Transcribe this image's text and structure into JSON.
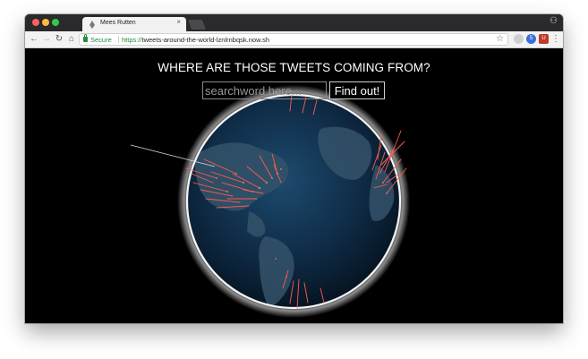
{
  "browser": {
    "tab_title": "Mees Rutten",
    "tab_close": "×",
    "secure_label": "Secure",
    "url_scheme": "https://",
    "url_rest": "tweets-around-the-world-lznlrnbqsk.now.sh",
    "icons": {
      "back": "back-arrow-icon",
      "forward": "forward-arrow-icon",
      "reload": "reload-icon",
      "home": "home-icon",
      "star": "bookmark-star-icon",
      "menu": "kebab-menu-icon",
      "profile": "incognito-profile-icon"
    },
    "glyphs": {
      "back": "←",
      "forward": "→",
      "reload": "↻",
      "home": "⌂",
      "star": "☆",
      "menu": "⋮",
      "profile": "⚇",
      "ext_badge": "5",
      "ext_shield": "U"
    }
  },
  "page": {
    "headline": "WHERE ARE THOSE TWEETS COMING FROM?",
    "search_placeholder": "searchword here...",
    "search_value": "",
    "find_button_label": "Find out!"
  },
  "colors": {
    "background": "#000000",
    "globe_glow": "#ffffff",
    "ocean": "#0d2a45",
    "tweet_spikes": "#ff5a4e"
  }
}
